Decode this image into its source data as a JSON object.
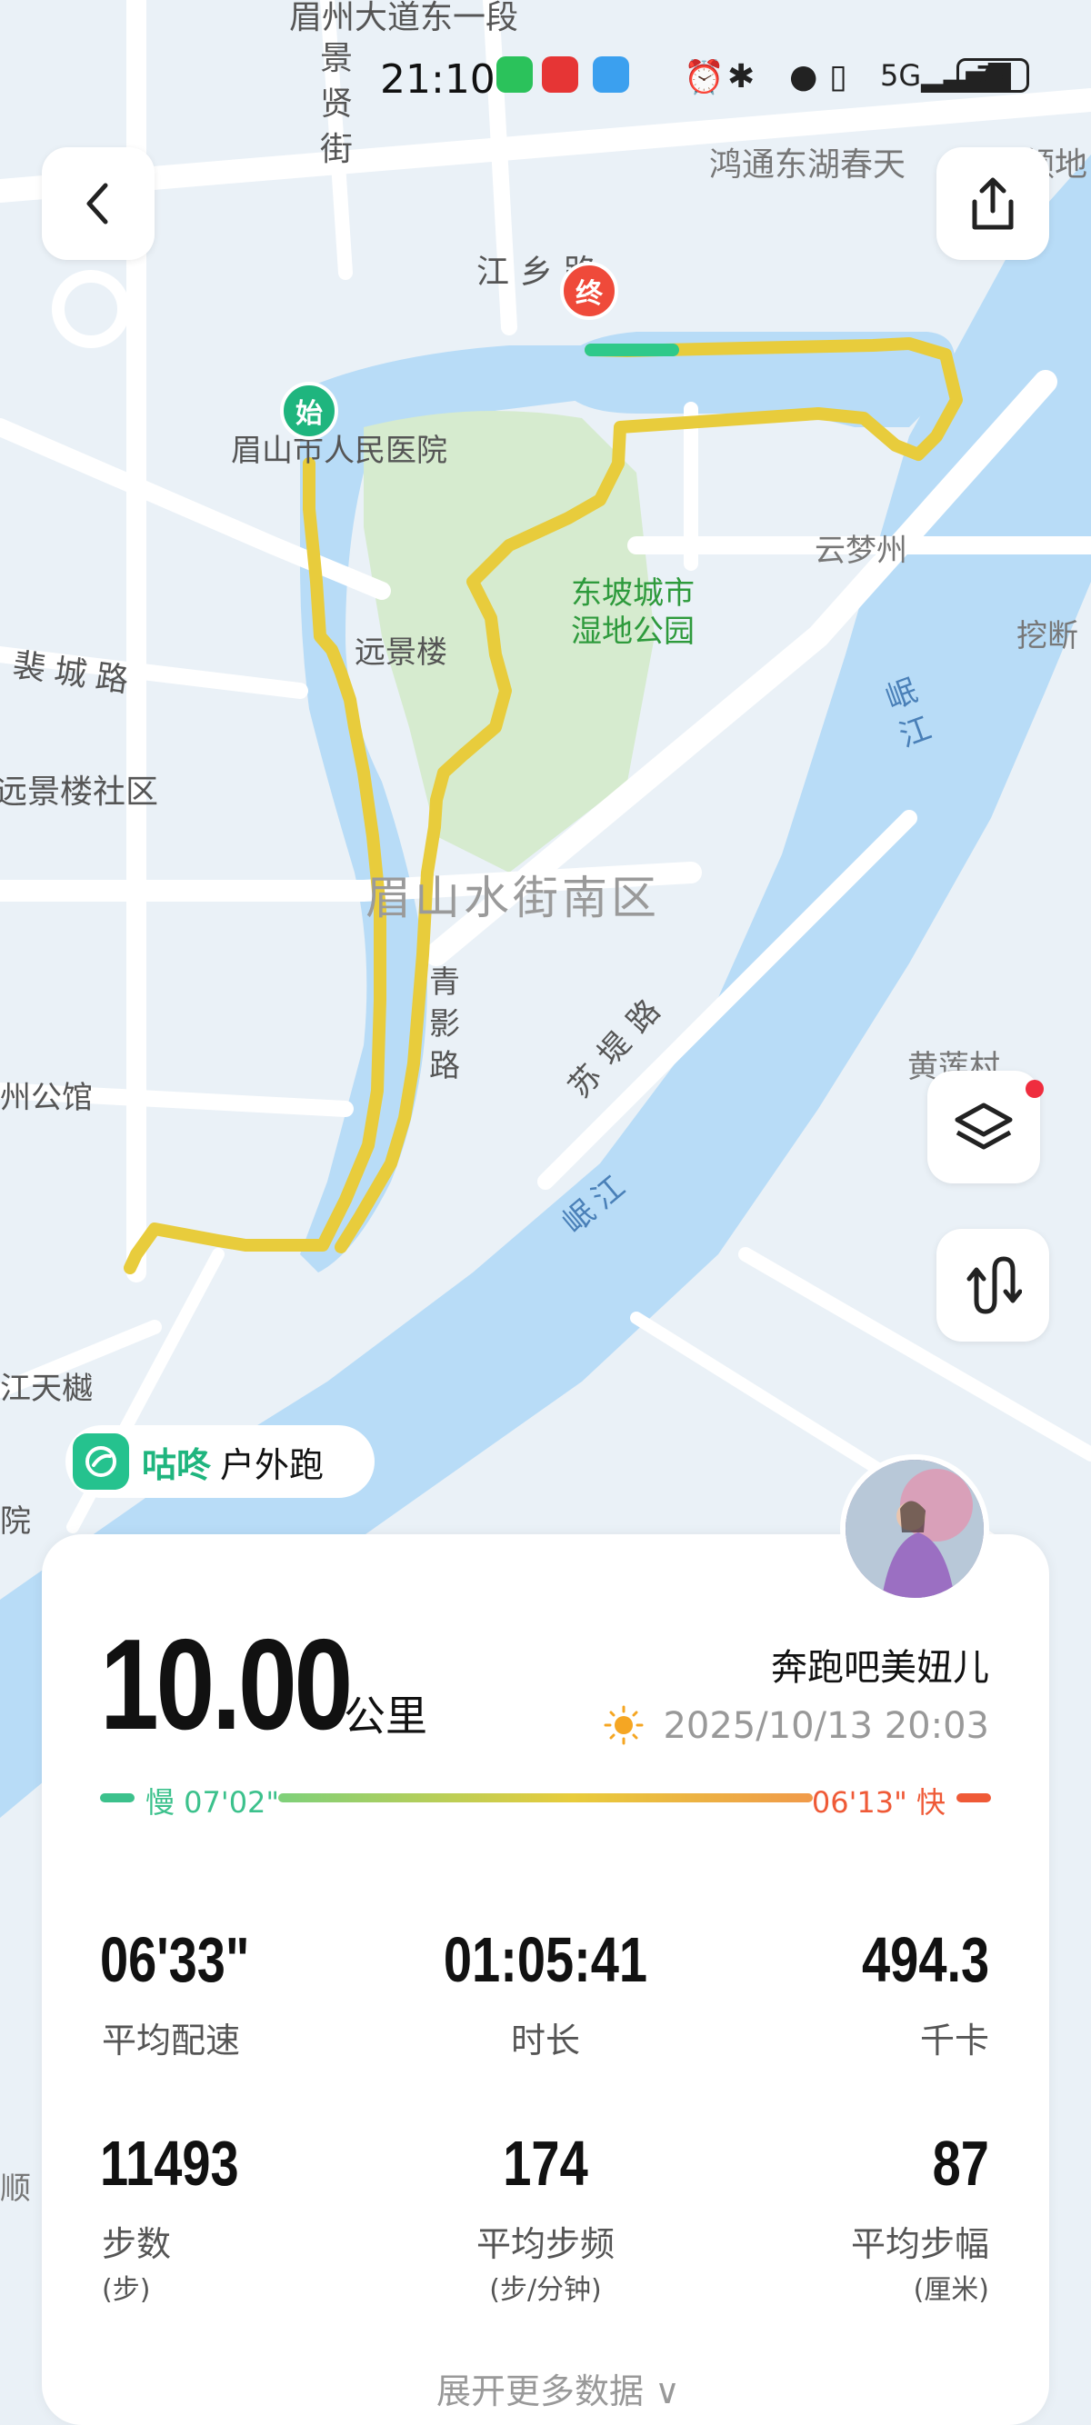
{
  "status_bar": {
    "time": "21:10",
    "battery": "73"
  },
  "map_labels": {
    "top_road": "眉州大道东一段",
    "jingxian": "景贤街",
    "hongtong": "鸿通东湖春天",
    "lingdi": "领地",
    "jiangxiang": "江乡路",
    "hospital": "眉山市人民医院",
    "dongpo_park": "东坡城市\n湿地公园",
    "yunmeng": "云梦州",
    "wajue": "挖断",
    "yuanjing_lou": "远景楼",
    "feicheng": "裴城路",
    "yuanjing_community": "远景楼社区",
    "minjiang1": "岷江",
    "shuijie": "眉山水街南区",
    "qingying": "青影路",
    "sudi": "苏堤路",
    "zhouguan": "州公馆",
    "huanglian": "黄莲村",
    "minjiang2": "岷江",
    "jiangtian": "江天樾",
    "yuan": "院",
    "shun": "顺"
  },
  "markers": {
    "start": "始",
    "end": "终"
  },
  "brand": {
    "name": "咕咚",
    "activity": "户外跑"
  },
  "summary": {
    "distance": "10.00",
    "distance_unit": "公里",
    "username": "奔跑吧美妞儿",
    "datetime": "2025/10/13 20:03",
    "pace_slow": "慢 07'02\"",
    "pace_fast": "06'13\" 快"
  },
  "stats": [
    {
      "value": "06'33\"",
      "label": "平均配速",
      "unit": ""
    },
    {
      "value": "01:05:41",
      "label": "时长",
      "unit": ""
    },
    {
      "value": "494.3",
      "label": "千卡",
      "unit": ""
    },
    {
      "value": "11493",
      "label": "步数",
      "unit": "(步)"
    },
    {
      "value": "174",
      "label": "平均步频",
      "unit": "(步/分钟)"
    },
    {
      "value": "87",
      "label": "平均步幅",
      "unit": "(厘米)"
    }
  ],
  "expand_label": "展开更多数据 ∨",
  "colors": {
    "route": "#e8cc3c",
    "route_start": "#2fc98a",
    "river": "#b8dcf7",
    "park": "#d6ebcf",
    "brand": "#1fb57e",
    "fast": "#ef5a37"
  }
}
